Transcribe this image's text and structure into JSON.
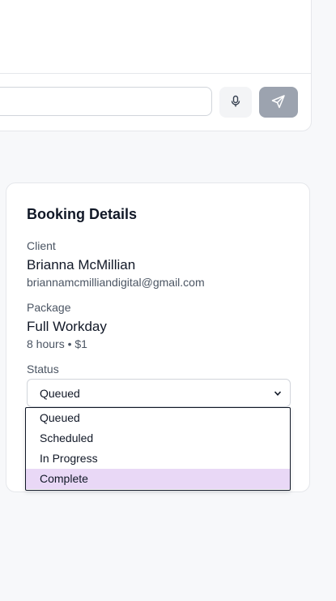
{
  "chat": {
    "input_value": "",
    "mic_icon": "microphone-icon",
    "send_icon": "send-icon"
  },
  "booking": {
    "title": "Booking Details",
    "client": {
      "label": "Client",
      "name": "Brianna McMillian",
      "email": "briannamcmilliandigital@gmail.com"
    },
    "package": {
      "label": "Package",
      "name": "Full Workday",
      "details": "8 hours • $1"
    },
    "status": {
      "label": "Status",
      "value": "Queued",
      "options": [
        "Queued",
        "Scheduled",
        "In Progress",
        "Complete"
      ],
      "highlighted": "Complete"
    }
  },
  "colors": {
    "send_button": "#9ca3af",
    "highlight": "#e9d8f6"
  }
}
